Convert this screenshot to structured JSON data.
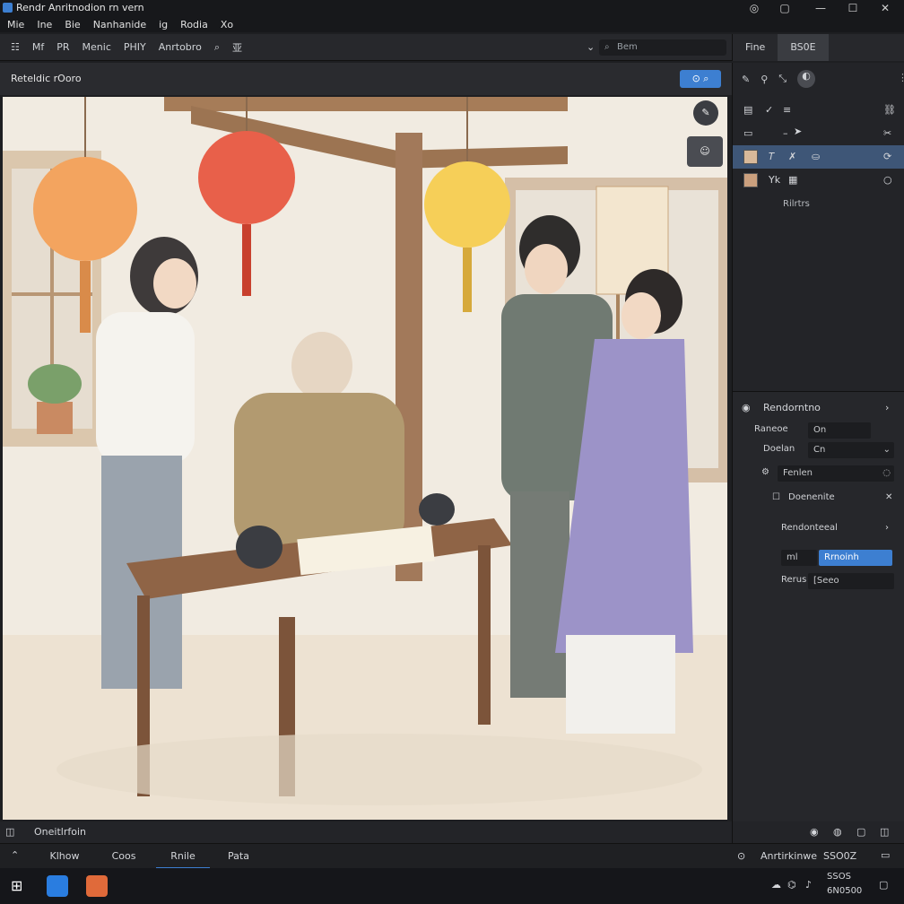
{
  "window": {
    "title": "Rendr Anritnodion rn vern",
    "controls": {
      "pin": "◎",
      "restore": "▢",
      "minimize": "—",
      "maximize": "☐",
      "close": "✕"
    }
  },
  "menubar": {
    "items": [
      "Mie",
      "Ine",
      "Bie",
      "Nanhanide",
      "ig",
      "Rodia",
      "Xo"
    ]
  },
  "toolbar": {
    "items": [
      "Mf",
      "PR",
      "Menic",
      "PHIY",
      "Anrtobro",
      "亚"
    ],
    "search_placeholder": "Bem"
  },
  "right_tabs": [
    "Fine",
    "BS0E"
  ],
  "canvas": {
    "header_label": "Reteldic rOoro",
    "zoom_button": "⊙ ⌕",
    "footer_label": "Oneitlrfoin"
  },
  "layers": {
    "rows": [
      {
        "label": "≡",
        "selected": false
      },
      {
        "label": "–",
        "selected": false
      },
      {
        "label": "✗",
        "selected": true
      },
      {
        "label": "Yk",
        "selected": false
      }
    ],
    "footer_label": "Rilrtrs"
  },
  "properties": {
    "title": "Rendorntno",
    "rows": [
      {
        "label": "Raneoe",
        "value": "On"
      },
      {
        "label": "Doelan",
        "value": "Cn"
      },
      {
        "label": "Fenlen",
        "value": ""
      },
      {
        "label": "Doenenite",
        "value": ""
      },
      {
        "label": "Rendonteeal",
        "value": ""
      }
    ],
    "toggle_left": "ml",
    "toggle_right": "Rrnoinh",
    "last_row_label": "Rerus",
    "last_row_value": "[Seeo"
  },
  "right_bottom": {},
  "bottom_tabs": [
    "Klhow",
    "Coos",
    "Rnile",
    "Pata"
  ],
  "status": {
    "left": "Anrtirkinwe",
    "right": "SSO0Z",
    "clock_line1": "SSOS",
    "clock_line2": "6N0500"
  },
  "colors": {
    "accent": "#3d7fd1",
    "selection": "#3e5677",
    "panel": "#232428",
    "lantern_red": "#e8604a",
    "lantern_orange": "#f3a45f",
    "lantern_yellow": "#f6cf58",
    "robe_purple": "#9c93c8"
  }
}
